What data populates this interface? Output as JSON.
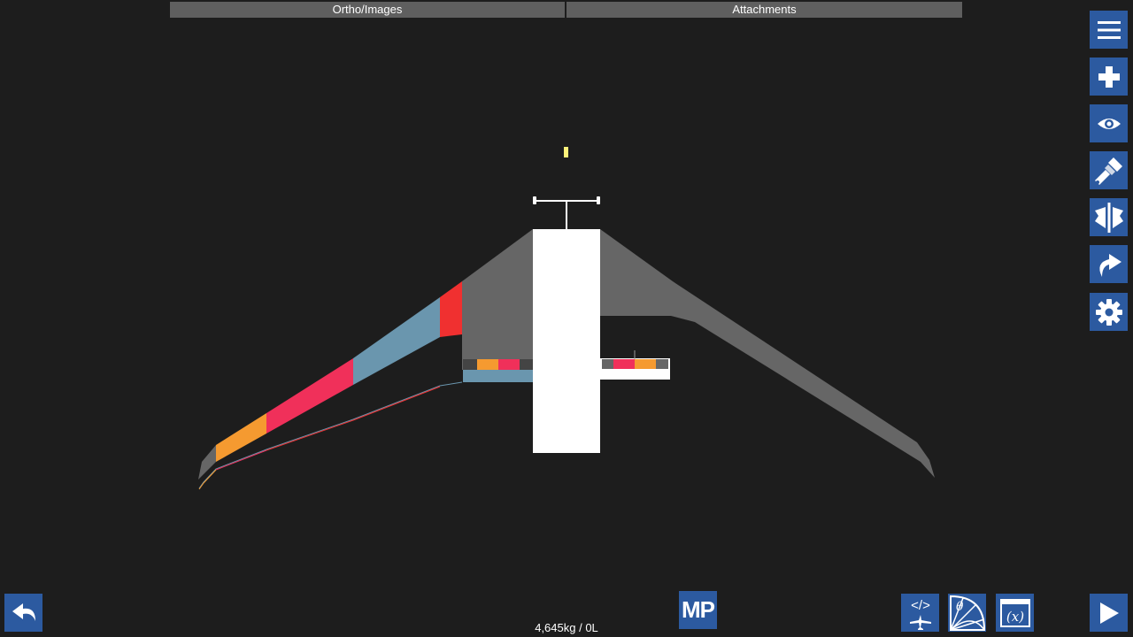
{
  "top_tabs": [
    {
      "label": "Ortho/Images"
    },
    {
      "label": "Attachments"
    }
  ],
  "toolbar_right": [
    {
      "icon": "menu-icon"
    },
    {
      "icon": "add-part-icon"
    },
    {
      "icon": "view-eye-icon"
    },
    {
      "icon": "paint-brush-icon"
    },
    {
      "icon": "symmetry-icon"
    },
    {
      "icon": "redo-icon"
    },
    {
      "icon": "settings-gear-icon"
    }
  ],
  "bottom": {
    "undo_icon": "undo-icon",
    "mp_label": "MP",
    "mass_readout": "4,645kg / 0L",
    "code_icon": "xml-code-plane-icon",
    "angle_icon": "theta-angle-icon",
    "variables_icon": "function-variables-icon",
    "play_icon": "play-icon"
  },
  "colors": {
    "background": "#1d1d1d",
    "button_blue": "#2c5aa0",
    "tab_gray": "#5f5f5f",
    "wing_gray": "#666666",
    "fuselage": "#ffffff",
    "paint_blue": "#6a96ae",
    "paint_red": "#f03030",
    "paint_pink": "#f0305a",
    "paint_orange": "#f59a30",
    "marker_yellow": "#fff27a"
  }
}
